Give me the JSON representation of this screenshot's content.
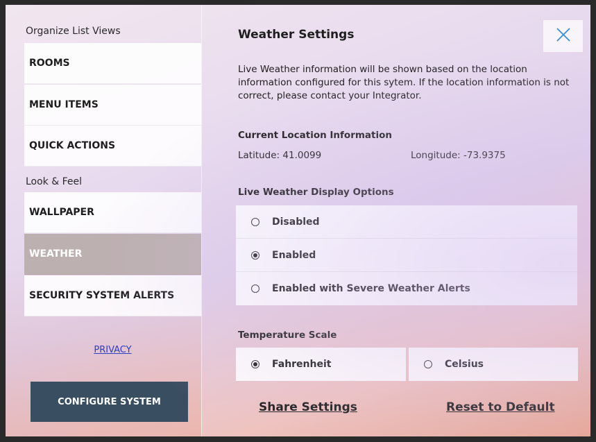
{
  "sidebar": {
    "organize_title": "Organize List Views",
    "organize_items": [
      {
        "label": "ROOMS"
      },
      {
        "label": "MENU ITEMS"
      },
      {
        "label": "QUICK ACTIONS"
      }
    ],
    "look_title": "Look & Feel",
    "look_items": [
      {
        "label": "WALLPAPER"
      },
      {
        "label": "WEATHER",
        "active": true
      },
      {
        "label": "SECURITY SYSTEM ALERTS"
      }
    ],
    "privacy_label": "PRIVACY",
    "configure_label": "CONFIGURE SYSTEM"
  },
  "main": {
    "title": "Weather Settings",
    "close_icon": "close-icon",
    "description": "Live Weather information will be shown based on the location information configured for this sytem. If the location information is not correct, please contact your Integrator.",
    "location_title": "Current Location Information",
    "latitude": "Latitude: 41.0099",
    "longitude": "Longitude: -73.9375",
    "display_options_title": "Live Weather Display Options",
    "display_options": [
      {
        "label": "Disabled",
        "selected": false
      },
      {
        "label": "Enabled",
        "selected": true
      },
      {
        "label": "Enabled with Severe Weather Alerts",
        "selected": false
      }
    ],
    "temperature_title": "Temperature Scale",
    "temperature_options": [
      {
        "label": "Fahrenheit",
        "selected": true
      },
      {
        "label": "Celsius",
        "selected": false
      }
    ],
    "share_label": "Share Settings",
    "reset_label": "Reset to Default"
  },
  "colors": {
    "active_item": "#bdb0b0",
    "configure_button": "#3a4e62",
    "link": "#2a3fc4"
  }
}
